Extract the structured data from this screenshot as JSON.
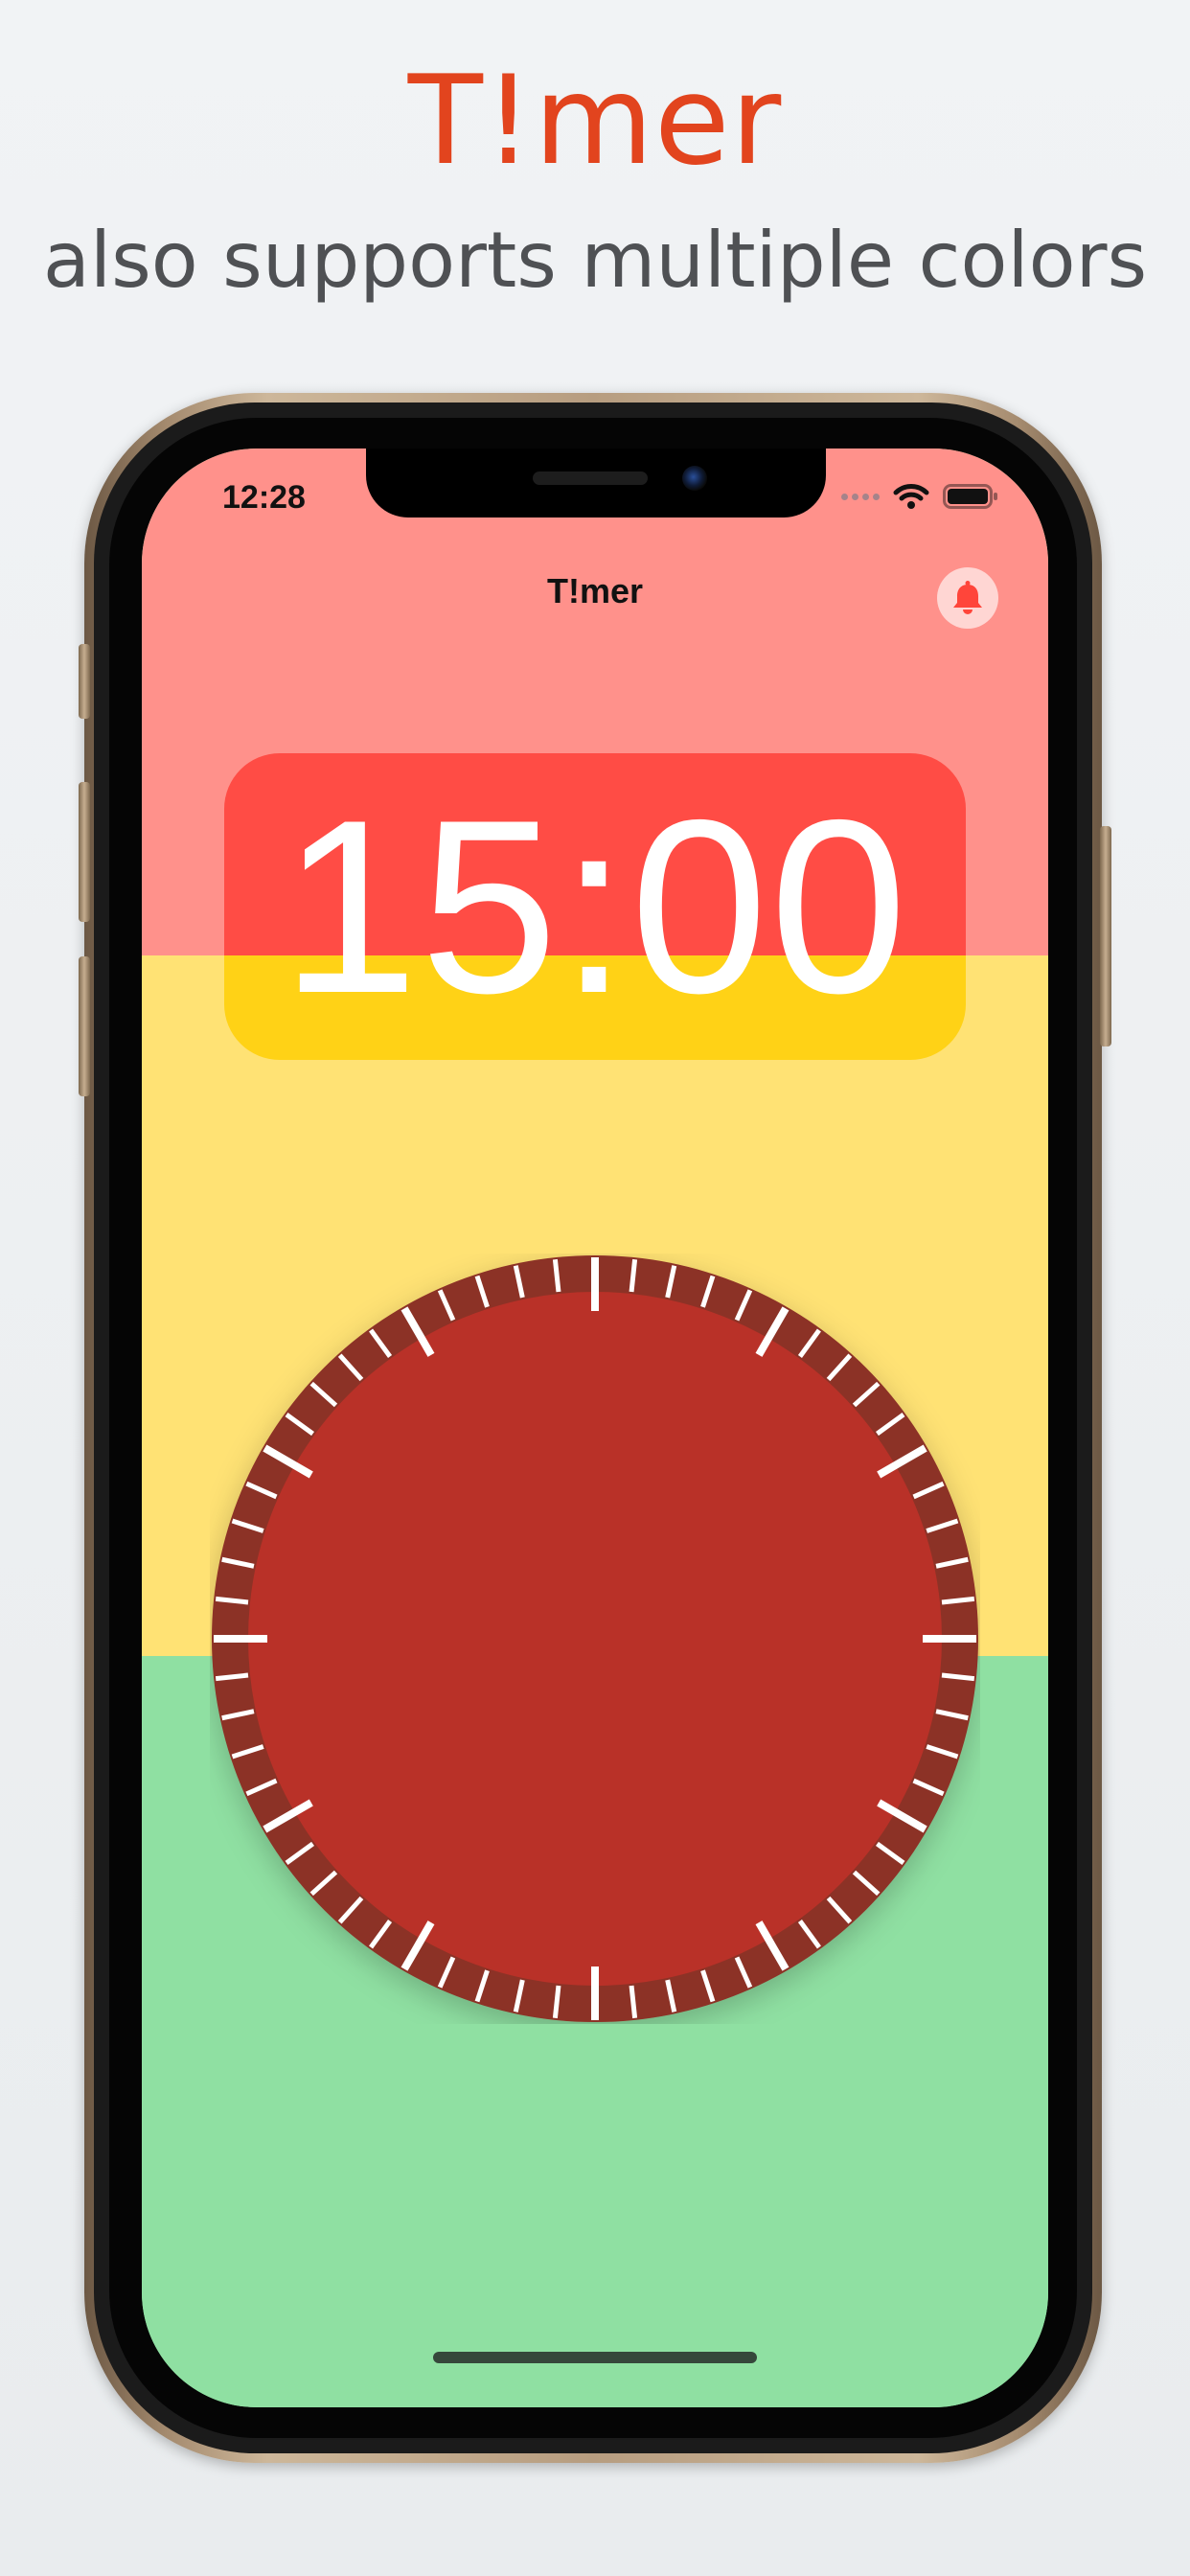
{
  "headline": {
    "title": "T!mer",
    "subtitle": "also supports multiple colors"
  },
  "status_bar": {
    "time": "12:28",
    "icons": [
      "cellular-signal-icon",
      "wifi-icon",
      "battery-icon"
    ]
  },
  "nav": {
    "title": "T!mer",
    "alarm_icon": "bell-icon"
  },
  "timer": {
    "display": "15:00",
    "dial_tick_count": 60,
    "major_tick_every": 5
  },
  "colors": {
    "headline_title": "#e2441e",
    "headline_subtitle": "#4f5154",
    "band_red": "#ff918b",
    "band_yellow": "#ffe274",
    "band_green": "#8fe0a2",
    "card_red": "#ff4c45",
    "card_yellow": "#ffd216",
    "dial_ring": "#8c3028",
    "dial_face": "#b93128",
    "bell": "#ff453a"
  }
}
